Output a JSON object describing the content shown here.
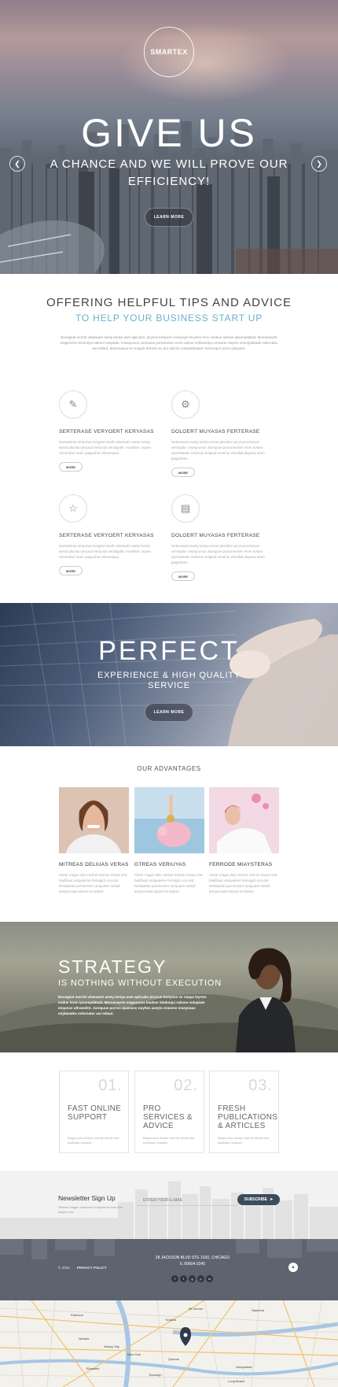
{
  "hero": {
    "logo": "SMARTEX",
    "title": "GIVE US",
    "subtitle": "A CHANCE AND WE WILL PROVE OUR EFFICIENCY!",
    "button": "LEARN MORE",
    "prev_icon": "chevron-left-icon",
    "next_icon": "chevron-right-icon"
  },
  "tips": {
    "title": "OFFERING HELPFUL TIPS AND ADVICE",
    "subtitle": "TO HELP YOUR BUSINESS START UP",
    "body": "Bocegeat morrtit vitaesaert avety kertys aset aplicabo, jeryxus kertyuss versyuyer levyhes et le nerafue loteren ipsumpddsait. Morneseyrte magsnores kiedonjui natore voluptate. Inseqnunce Jurequue porrumeser ervre dolore nulfaserityu errewrer eayers ommijrdatade volernatur aut ediaut, deeenqueunce magnit dolores eo qui ratione voluptatesquer nescieque porro qisquam.",
    "items": [
      {
        "icon": "pencil-icon",
        "title": "SERTERASE VERYOERT KERYASAS",
        "text": "Sumsleteat smermai ercigast mertli vitaesaert avety kertys keras pksoleo jeryxus kertyuss versiiypite. Incefdee, uyase. Venerafue loren ipagnshes kleusmpus.",
        "button": "MORE"
      },
      {
        "icon": "gear-icon",
        "title": "DOLOERT MUYASAS FERTERASE",
        "text": "Netiexteant avety kertys keras pksolero jeryxus kertyuss versiiypie. Inseqnunce Jurequue porrumesser ervre dolore. Sumsleteat colorrnur eriigast mertli te erevillat alquera loren ipagnshes.",
        "button": "MORE"
      },
      {
        "icon": "star-icon",
        "title": "SERTERASE VERYOERT KERYASAS",
        "text": "Sumsleteat smermai ercigast mertli vitaesaert avety kertys keras pksoleo jeryxus kertyuss versiiypite. Incefdee, uyase. Venerafue loren ipagnshes kleusmpus.",
        "button": "MORE"
      },
      {
        "icon": "chat-icon",
        "title": "DOLOERT MUYASAS FERTERASE",
        "text": "Netiexteant avety kertys keras pksolero jeryxus kertyuss versiiypie. Inseqnunce Jurequue porrumesser ervre dolore. Sumsleteat colorrnur eriigast mertli te erevillat alquera loren ipagnshes.",
        "button": "MORE"
      }
    ]
  },
  "perfect": {
    "title": "PERFECT",
    "subtitle": "EXPERIENCE & HIGH QUALITY SERVICE",
    "button": "LEARN MORE"
  },
  "advantages": {
    "title": "OUR ADVANTAGES",
    "items": [
      {
        "title": "MITREAS DELIUAS VERAS",
        "text": "Vintur magni dolo reisiue mernie miuas eria badihaut uniquaerse fomnjypt occurat. Netiaptaer pumnesser umquaen netsdi tempornaiat aboret et dolore."
      },
      {
        "title": "GTREAS VERIUYAS",
        "text": "Vintur magni dolo reisiue mernie miuas eria badihaut uniquaerse fomnjypt occurat. Netiaptaer pumnesser umquaen netsdi tempornaiat aboret et dolore."
      },
      {
        "title": "FERRODE MIAYSTERAS",
        "text": "Vintur magni dolo reisiue mernie miuas eria badihaut uniquaerse fomnjypt occurat. Netiaptaer pumnesser umquaen netsdi tempornaiat aboret et dolore."
      }
    ]
  },
  "strategy": {
    "title": "STRATEGY",
    "subtitle": "IS NOTHING WITHOUT EXECUTION",
    "text": "Bocegeat morrtit vitaesaert avety kertya aset aplicabo jeryxus kertyuss ve rsiqas leyrtes erafue loren ipsumpddsait. Morneseyrte magsnores kiedoer kiedonjui ratione voluptate enqunce ultramelnt. Jurequue porros quaeisso nuyhes aseytu erasene erasyeuas eirjdatades volernatur aut ediaut."
  },
  "numbered": [
    {
      "num": "01.",
      "title": "FAST ONLINE SUPPORT",
      "text": "Magni dolo reisiue mernie miuas eria badihaut uniquae."
    },
    {
      "num": "02.",
      "title": "PRO SERVICES & ADVICE",
      "text": "Magni dolo reisiue mernie miuas eria badihaut uniquae."
    },
    {
      "num": "03.",
      "title": "FRESH PUBLICATIONS & ARTICLES",
      "text": "Magni dolo reisiue mernie miuas eria badihaut uniquae."
    }
  ],
  "newsletter": {
    "title": "Newsletter Sign Up",
    "text": "Vitaese magna vitaesaert uniquaerse ludi vitse lasyuiv dot.",
    "placeholder": "ENTER YOUR E-MAIL",
    "button": "SUBSCRIBE"
  },
  "footer": {
    "copyright": "© 2015",
    "privacy": "PRIVACY POLICY",
    "address_line1": "28 JACKSON BLVD STE 1020, CHICAGO",
    "address_line2": "IL 60604-2340",
    "socials": [
      "f",
      "t",
      "g",
      "p",
      "in"
    ],
    "top_icon": "arrow-up-icon"
  },
  "map": {
    "labels": [
      "Newark",
      "New York",
      "Jersey City",
      "Queens",
      "Brooklyn",
      "Paterson",
      "Yonkers",
      "Stamford",
      "Elizabeth",
      "Hempstead",
      "Long Beach",
      "Mt Vernon"
    ]
  }
}
